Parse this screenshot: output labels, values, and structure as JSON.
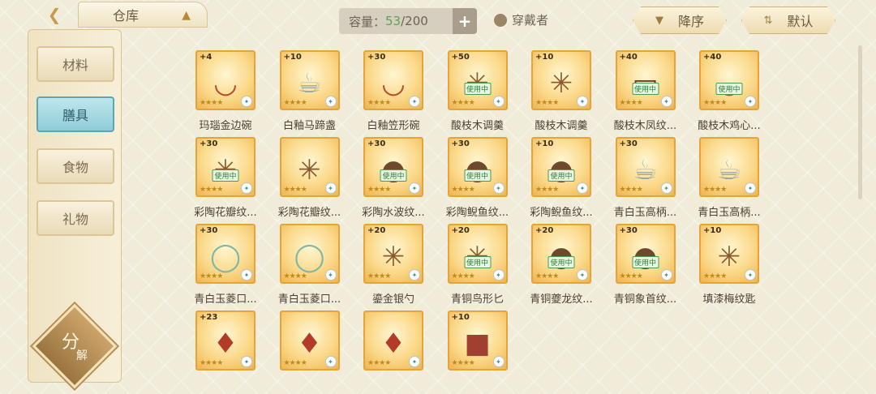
{
  "header": {
    "title": "仓库",
    "capacity_label": "容量：",
    "capacity_current": "53",
    "capacity_max": "/200",
    "wearer_label": "穿戴者",
    "sort_label": "降序",
    "filter_label": "默认"
  },
  "sidebar": {
    "items": [
      {
        "label": "材料"
      },
      {
        "label": "膳具"
      },
      {
        "label": "食物"
      },
      {
        "label": "礼物"
      }
    ],
    "active": "膳具",
    "decompose_a": "分",
    "decompose_b": "解"
  },
  "items": [
    {
      "level": "+4",
      "name": "玛瑙金边碗",
      "in_use": false,
      "icon": "bowl-icon",
      "stars": 4
    },
    {
      "level": "+10",
      "name": "白釉马蹄盏",
      "in_use": false,
      "icon": "cup-icon",
      "stars": 4
    },
    {
      "level": "+30",
      "name": "白釉笠形碗",
      "in_use": false,
      "icon": "bowl-icon",
      "stars": 4
    },
    {
      "level": "+50",
      "name": "酸枝木调羹",
      "in_use": true,
      "icon": "spoon-icon",
      "stars": 4
    },
    {
      "level": "+10",
      "name": "酸枝木调羹",
      "in_use": false,
      "icon": "spoon-icon",
      "stars": 4
    },
    {
      "level": "+40",
      "name": "酸枝木凤纹...",
      "in_use": true,
      "icon": "tray-icon",
      "stars": 4
    },
    {
      "level": "+40",
      "name": "酸枝木鸡心...",
      "in_use": true,
      "icon": "bowl-icon",
      "stars": 4
    },
    {
      "level": "+30",
      "name": "彩陶花瓣纹...",
      "in_use": true,
      "icon": "spoon-icon",
      "stars": 4
    },
    {
      "level": "",
      "name": "彩陶花瓣纹...",
      "in_use": false,
      "icon": "spoon-icon",
      "stars": 4
    },
    {
      "level": "+30",
      "name": "彩陶水波纹...",
      "in_use": true,
      "icon": "pot-icon",
      "stars": 4
    },
    {
      "level": "+30",
      "name": "彩陶鲵鱼纹...",
      "in_use": true,
      "icon": "pot-icon",
      "stars": 4
    },
    {
      "level": "+10",
      "name": "彩陶鲵鱼纹...",
      "in_use": true,
      "icon": "pot-icon",
      "stars": 4
    },
    {
      "level": "+30",
      "name": "青白玉高柄...",
      "in_use": false,
      "icon": "cup-icon",
      "stars": 4
    },
    {
      "level": "",
      "name": "青白玉高柄...",
      "in_use": false,
      "icon": "cup-icon",
      "stars": 4
    },
    {
      "level": "+30",
      "name": "青白玉菱口...",
      "in_use": false,
      "icon": "plate-icon",
      "stars": 4
    },
    {
      "level": "",
      "name": "青白玉菱口...",
      "in_use": false,
      "icon": "plate-icon",
      "stars": 4
    },
    {
      "level": "+20",
      "name": "鎏金银勺",
      "in_use": false,
      "icon": "spoon-icon",
      "stars": 4
    },
    {
      "level": "+20",
      "name": "青铜鸟形匕",
      "in_use": true,
      "icon": "spoon-icon",
      "stars": 4
    },
    {
      "level": "+20",
      "name": "青铜夔龙纹...",
      "in_use": true,
      "icon": "pot-icon",
      "stars": 4
    },
    {
      "level": "+30",
      "name": "青铜象首纹...",
      "in_use": true,
      "icon": "pot-icon",
      "stars": 4
    },
    {
      "level": "+10",
      "name": "填漆梅纹匙",
      "in_use": false,
      "icon": "spoon-icon",
      "stars": 4
    },
    {
      "level": "+23",
      "name": "",
      "in_use": false,
      "icon": "vase-icon",
      "stars": 4
    },
    {
      "level": "",
      "name": "",
      "in_use": false,
      "icon": "vase-icon",
      "stars": 4
    },
    {
      "level": "",
      "name": "",
      "in_use": false,
      "icon": "vase-icon",
      "stars": 4
    },
    {
      "level": "+10",
      "name": "",
      "in_use": false,
      "icon": "box-icon",
      "stars": 4
    }
  ],
  "in_use_label": "使用中",
  "colors": {
    "accent": "#e3a43a",
    "active_tab": "#8fcdd8",
    "in_use": "#2e7d32"
  }
}
